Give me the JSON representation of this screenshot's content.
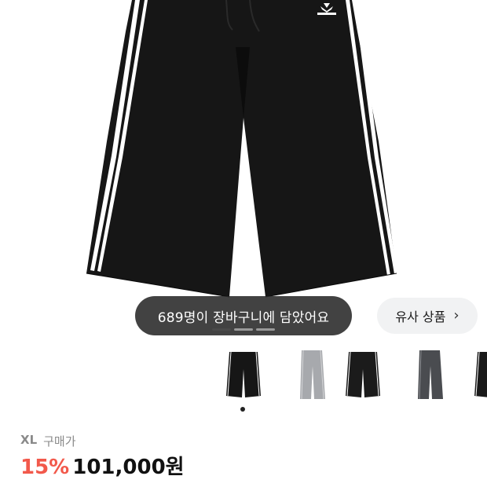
{
  "product": {
    "brand_mark": "adidas",
    "image_alt": "black wide track pants with three white side stripes"
  },
  "cart_notice": "689명이 장바구니에 담았어요",
  "similar_button": {
    "label": "유사 상품",
    "icon": "chevron-right-icon"
  },
  "image_pager": {
    "count": 3,
    "active_index": 0
  },
  "color_options": [
    {
      "name": "black-shorts",
      "color": "#161616",
      "stripe": "#ffffff"
    },
    {
      "name": "grey-wide",
      "color": "#a7a9ad",
      "stripe": "#d5d6d8"
    },
    {
      "name": "black-shorts-2",
      "color": "#1b1b1b",
      "stripe": "#ffffff"
    },
    {
      "name": "charcoal-wide",
      "color": "#4a4c50",
      "stripe": "#8c8e92"
    },
    {
      "name": "black-partial",
      "color": "#1a1a1a",
      "stripe": "#ffffff"
    }
  ],
  "selected_option": {
    "size": "XL",
    "label": "구매가"
  },
  "price": {
    "discount": "15%",
    "amount": "101,000원"
  },
  "colors": {
    "accent": "#f2594b",
    "pill_bg": "#2e2e2e",
    "button_bg": "#f1f2f3"
  }
}
